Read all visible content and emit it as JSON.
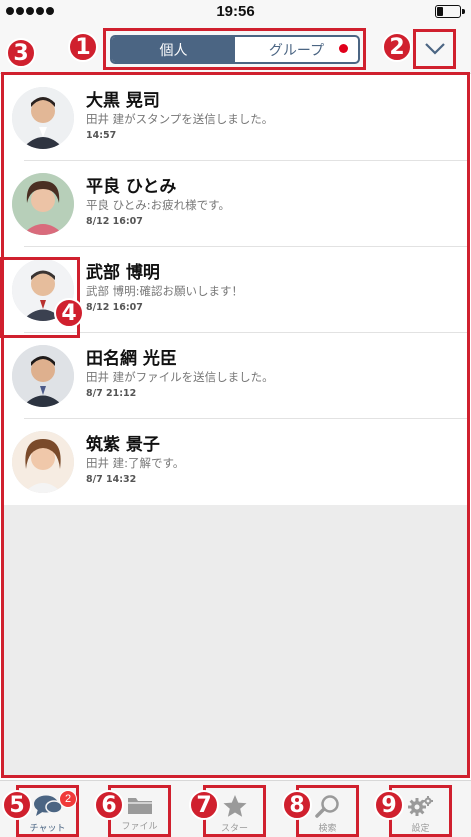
{
  "status": {
    "time": "19:56",
    "battery_level": 0.25
  },
  "header": {
    "tabs": [
      {
        "label": "個人",
        "active": true
      },
      {
        "label": "グループ",
        "active": false,
        "has_unread_dot": true
      }
    ]
  },
  "annotations": [
    "1",
    "2",
    "3",
    "4",
    "5",
    "6",
    "7",
    "8",
    "9"
  ],
  "chats": [
    {
      "name": "大黒 晃司",
      "message": "田井 建がスタンプを送信しました。",
      "date": "14:57",
      "avatar_bg": "#e9ecef"
    },
    {
      "name": "平良 ひとみ",
      "message": "平良 ひとみ:お疲れ様です。",
      "date": "8/12 16:07",
      "avatar_bg": "#c7d9c9"
    },
    {
      "name": "武部 博明",
      "message": "武部 博明:確認お願いします！",
      "date": "8/12 16:07",
      "avatar_bg": "#eef0f2"
    },
    {
      "name": "田名網 光臣",
      "message": "田井 建がファイルを送信しました。",
      "date": "8/7 21:12",
      "avatar_bg": "#d7dade"
    },
    {
      "name": "筑紫 景子",
      "message": "田井 建:了解です。",
      "date": "8/7 14:32",
      "avatar_bg": "#f1e4d6"
    }
  ],
  "tabbar": {
    "items": [
      {
        "label": "チャット",
        "icon": "chat-icon",
        "badge": "2",
        "active": true
      },
      {
        "label": "ファイル",
        "icon": "folder-icon"
      },
      {
        "label": "スター",
        "icon": "star-icon"
      },
      {
        "label": "検索",
        "icon": "search-icon"
      },
      {
        "label": "設定",
        "icon": "gear-icon"
      }
    ]
  },
  "colors": {
    "accent": "#4b6583",
    "annotation": "#d0202e",
    "notification": "#f03a3a"
  }
}
